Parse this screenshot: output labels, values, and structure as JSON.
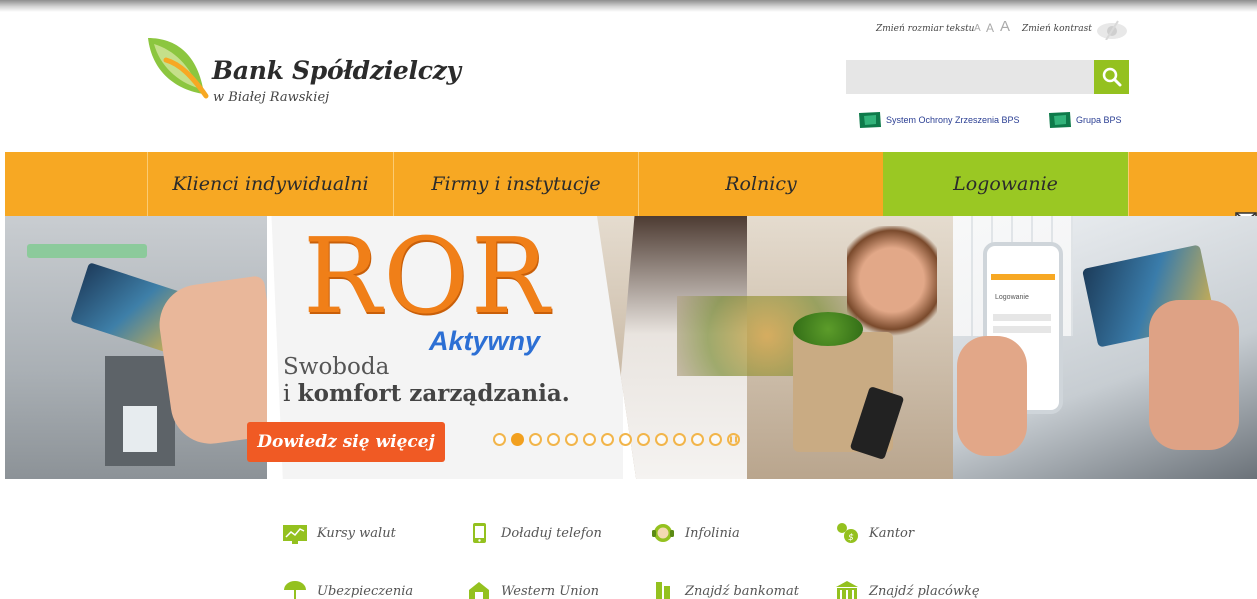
{
  "brand": {
    "name": "Bank Spółdzielczy",
    "subtitle": "w Białej Rawskiej"
  },
  "accessibility": {
    "resize_label": "Zmień rozmiar tekstu",
    "size_small": "A",
    "size_medium": "A",
    "size_large": "A",
    "contrast_label": "Zmień kontrast"
  },
  "search": {
    "placeholder": ""
  },
  "top_links": [
    {
      "label": "System Ochrony Zrzeszenia BPS"
    },
    {
      "label": "Grupa BPS"
    }
  ],
  "nav": [
    {
      "label": "Klienci indywidualni"
    },
    {
      "label": "Firmy i instytucje"
    },
    {
      "label": "Rolnicy"
    },
    {
      "label": "Logowanie"
    }
  ],
  "banner": {
    "title": "ROR",
    "subtitle": "Aktywny",
    "line1": "Swoboda",
    "line2_prefix": "i",
    "line2_bold": "komfort zarządzania.",
    "cta": "Dowiedz się więcej",
    "slide_count": 13,
    "active_slide": 2,
    "phone_screen_title": "Logowanie"
  },
  "quick_links": [
    {
      "label": "Kursy walut",
      "icon": "chart-icon"
    },
    {
      "label": "Doładuj telefon",
      "icon": "phone-icon"
    },
    {
      "label": "Infolinia",
      "icon": "headset-icon"
    },
    {
      "label": "Kantor",
      "icon": "money-bag-icon"
    },
    {
      "label": "Ubezpieczenia",
      "icon": "umbrella-icon"
    },
    {
      "label": "Western Union",
      "icon": "globe-icon"
    },
    {
      "label": "Znajdź bankomat",
      "icon": "atm-icon"
    },
    {
      "label": "Znajdź placówkę",
      "icon": "bank-building-icon"
    }
  ],
  "colors": {
    "nav_orange": "#f7a823",
    "login_green": "#9ac823",
    "accent_green": "#94c11f",
    "cta_red": "#f05a24",
    "link_blue": "#2a3e93"
  }
}
